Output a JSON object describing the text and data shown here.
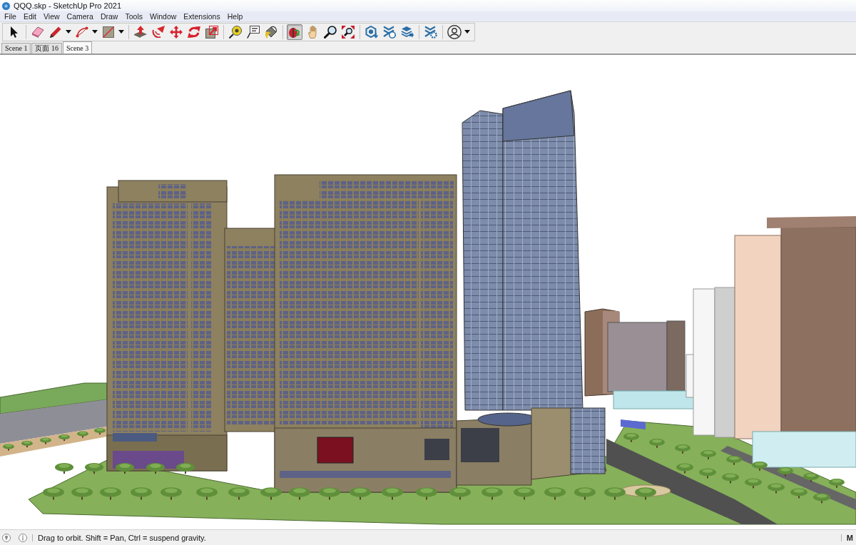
{
  "window": {
    "title": "QQQ.skp - SketchUp Pro 2021"
  },
  "menu": [
    "File",
    "Edit",
    "View",
    "Camera",
    "Draw",
    "Tools",
    "Window",
    "Extensions",
    "Help"
  ],
  "toolbar": {
    "groups": [
      {
        "tools": [
          {
            "kind": "select",
            "selected": false,
            "dropdown": false
          }
        ]
      },
      {
        "tools": [
          {
            "kind": "eraser",
            "selected": false,
            "dropdown": false
          },
          {
            "kind": "pencil",
            "selected": false,
            "dropdown": true
          },
          {
            "kind": "arc",
            "selected": false,
            "dropdown": true
          },
          {
            "kind": "rectangle",
            "selected": false,
            "dropdown": true
          }
        ]
      },
      {
        "tools": [
          {
            "kind": "push_pull",
            "selected": false,
            "dropdown": false
          },
          {
            "kind": "follow_me",
            "selected": false,
            "dropdown": false
          },
          {
            "kind": "move",
            "selected": false,
            "dropdown": false
          },
          {
            "kind": "rotate",
            "selected": false,
            "dropdown": false
          },
          {
            "kind": "scale",
            "selected": false,
            "dropdown": false
          }
        ]
      },
      {
        "tools": [
          {
            "kind": "tape",
            "selected": false,
            "dropdown": false
          },
          {
            "kind": "text",
            "selected": false,
            "dropdown": false
          },
          {
            "kind": "paint",
            "selected": false,
            "dropdown": false
          }
        ]
      },
      {
        "tools": [
          {
            "kind": "orbit",
            "selected": true,
            "dropdown": false
          },
          {
            "kind": "pan",
            "selected": false,
            "dropdown": false
          },
          {
            "kind": "zoom",
            "selected": false,
            "dropdown": false
          },
          {
            "kind": "zoom_extents",
            "selected": false,
            "dropdown": false
          }
        ]
      },
      {
        "tools": [
          {
            "kind": "hexagon",
            "selected": false,
            "dropdown": false
          },
          {
            "kind": "chevrons_circle",
            "selected": false,
            "dropdown": false
          },
          {
            "kind": "layers_arrow",
            "selected": false,
            "dropdown": false
          }
        ]
      },
      {
        "tools": [
          {
            "kind": "chevrons_gear",
            "selected": false,
            "dropdown": false
          }
        ]
      },
      {
        "tools": [
          {
            "kind": "profile",
            "selected": false,
            "dropdown": true
          }
        ]
      }
    ]
  },
  "scene_tabs": [
    {
      "label": "Scene 1",
      "selected": false
    },
    {
      "label": "页面 16",
      "selected": false
    },
    {
      "label": "Scene 3",
      "selected": true
    }
  ],
  "status_bar": {
    "message": "Drag to orbit. Shift = Pan, Ctrl = suspend gravity.",
    "measurements_label": "M"
  }
}
